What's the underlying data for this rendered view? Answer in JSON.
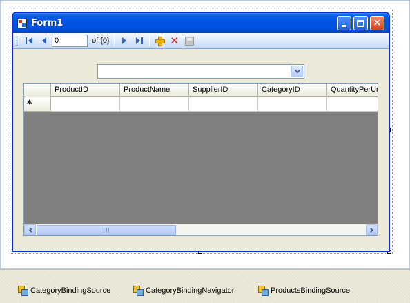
{
  "form": {
    "title": "Form1"
  },
  "navigator": {
    "position_value": "0",
    "count_label": "of {0}"
  },
  "combo": {
    "value": ""
  },
  "grid": {
    "columns": [
      "ProductID",
      "ProductName",
      "SupplierID",
      "CategoryID",
      "QuantityPerUnit"
    ],
    "new_row_marker": "*"
  },
  "tray": {
    "items": [
      "CategoryBindingSource",
      "CategoryBindingNavigator",
      "ProductsBindingSource"
    ]
  }
}
